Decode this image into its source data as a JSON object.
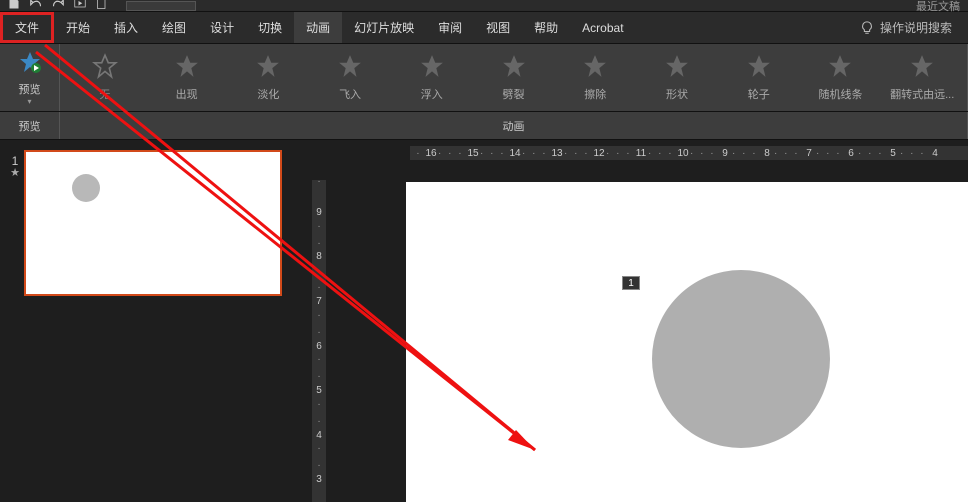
{
  "qat": {
    "recent_label": "最近文稿"
  },
  "menu": {
    "file": "文件",
    "home": "开始",
    "insert": "插入",
    "draw": "绘图",
    "design": "设计",
    "transition": "切换",
    "animation": "动画",
    "slideshow": "幻灯片放映",
    "review": "审阅",
    "view": "视图",
    "help": "帮助",
    "acrobat": "Acrobat",
    "tell_me": "操作说明搜索"
  },
  "ribbon": {
    "preview": "预览",
    "preview_group_label": "预览",
    "anim_group_label": "动画",
    "animations": [
      {
        "label": "无",
        "key": "none"
      },
      {
        "label": "出现",
        "key": "appear"
      },
      {
        "label": "淡化",
        "key": "fade"
      },
      {
        "label": "飞入",
        "key": "flyin"
      },
      {
        "label": "浮入",
        "key": "floatin"
      },
      {
        "label": "劈裂",
        "key": "split"
      },
      {
        "label": "擦除",
        "key": "wipe"
      },
      {
        "label": "形状",
        "key": "shape"
      },
      {
        "label": "轮子",
        "key": "wheel"
      },
      {
        "label": "随机线条",
        "key": "randombars"
      },
      {
        "label": "翻转式由远...",
        "key": "grow"
      }
    ]
  },
  "thumbs": {
    "slide_number": "1"
  },
  "canvas": {
    "anim_tag": "1"
  },
  "hruler": [
    "16",
    "15",
    "14",
    "13",
    "12",
    "11",
    "10",
    "9",
    "8",
    "7",
    "6",
    "5",
    "4"
  ],
  "vruler": [
    "9",
    "8",
    "7",
    "6",
    "5",
    "4",
    "3"
  ]
}
